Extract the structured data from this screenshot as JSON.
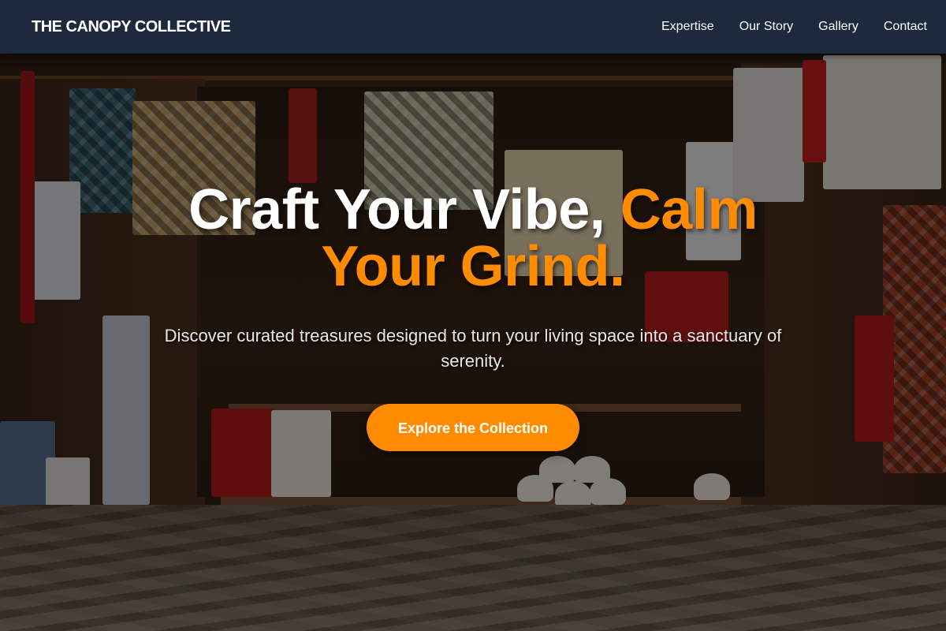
{
  "nav": {
    "brand": "THE CANOPY COLLECTIVE",
    "links": [
      "Expertise",
      "Our Story",
      "Gallery",
      "Contact"
    ]
  },
  "hero": {
    "headline_white": "Craft Your Vibe, ",
    "headline_accent": "Calm Your Grind.",
    "subtitle": "Discover curated treasures designed to turn your living space into a sanctuary of serenity.",
    "cta_label": "Explore the Collection",
    "background_image": "market-stall-with-textiles-hats-and-souvenirs"
  },
  "colors": {
    "accent": "#ff8c00",
    "navbar": "#1d2a3d",
    "text": "#ffffff"
  }
}
